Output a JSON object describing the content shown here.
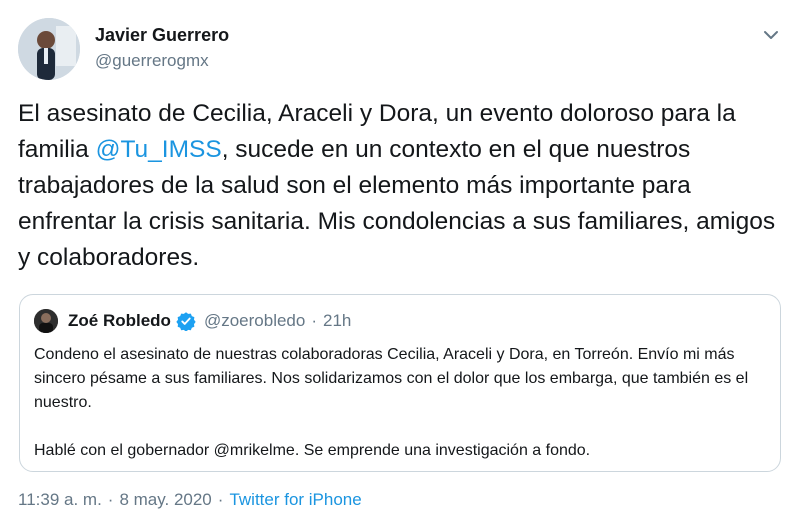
{
  "author": {
    "name": "Javier Guerrero",
    "handle": "@guerrerogmx"
  },
  "tweet": {
    "text_before": "El asesinato de Cecilia, Araceli y Dora, un evento doloroso para la familia ",
    "mention": "@Tu_IMSS",
    "text_after": ", sucede en un contexto en el que nuestros trabajadores de la salud son el elemento más importante para enfrentar la crisis sanitaria. Mis condolencias a sus familiares, amigos y colaboradores."
  },
  "quoted": {
    "name": "Zoé Robledo",
    "handle": "@zoerobledo",
    "dot": "·",
    "time": "21h",
    "paragraph1": "Condeno el asesinato de nuestras colaboradoras Cecilia, Araceli y Dora, en Torreón. Envío mi más sincero pésame a sus familiares. Nos solidarizamos con el dolor que los embarga, que también es el nuestro.",
    "paragraph2": "Hablé con el gobernador @mrikelme. Se emprende una investigación a fondo."
  },
  "footer": {
    "time": "11:39 a. m.",
    "dot1": "·",
    "date": "8 may. 2020",
    "dot2": "·",
    "source": "Twitter for iPhone"
  },
  "icons": {
    "more": "chevron-down-icon",
    "verified": "verified-badge-icon"
  },
  "colors": {
    "link": "#1b95e0",
    "secondary_text": "#657786",
    "border": "#ccd6dd"
  }
}
